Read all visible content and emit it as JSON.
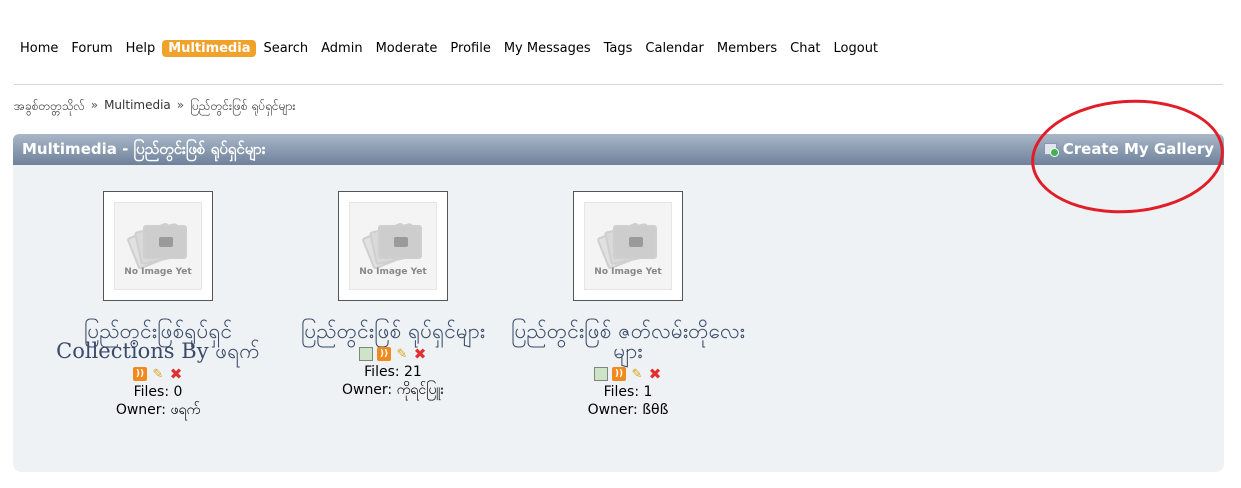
{
  "nav": {
    "items": [
      "Home",
      "Forum",
      "Help",
      "Multimedia",
      "Search",
      "Admin",
      "Moderate",
      "Profile",
      "My Messages",
      "Tags",
      "Calendar",
      "Members",
      "Chat",
      "Logout"
    ],
    "active_index": 3
  },
  "breadcrumb": [
    "အခွစ်တတ္တသိုလ်",
    "Multimedia",
    "ပြည်တွင်းဖြစ် ရုပ်ရှင်များ"
  ],
  "breadcrumb_sep": "»",
  "header": {
    "title": "Multimedia - ပြည်တွင်းဖြစ် ရုပ်ရှင်များ",
    "create_label": "Create My Gallery"
  },
  "placeholder_text": "No Image Yet",
  "galleries": [
    {
      "name": "ပြည်တွင်းဖြစ်ရုပ်ရှင် Collections By ဖရက်",
      "files": "Files: 0",
      "owner": "Owner: ဖရက်",
      "actions": [
        "rss",
        "edit",
        "delete"
      ]
    },
    {
      "name": "ပြည်တွင်းဖြစ် ရုပ်ရှင်များ",
      "files": "Files: 21",
      "owner": "Owner: ကိုရင်ပြူး",
      "actions": [
        "subscribe",
        "rss",
        "edit",
        "delete"
      ]
    },
    {
      "name": "ပြည်တွင်းဖြစ် ဇတ်လမ်းတိုလေးများ",
      "files": "Files: 1",
      "owner": "Owner: ßθß",
      "actions": [
        "subscribe",
        "rss",
        "edit",
        "delete"
      ]
    }
  ],
  "colors": {
    "accent": "#f0a22a",
    "header_top": "#a9b7c8",
    "header_bottom": "#6f829b",
    "annotation": "#e11d27"
  }
}
